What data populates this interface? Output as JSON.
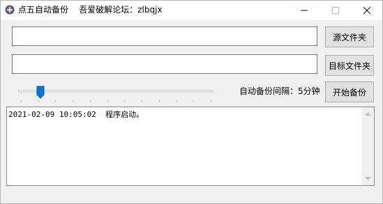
{
  "titlebar": {
    "title": "点五自动备份    吾爱破解论坛：zlbqjx"
  },
  "buttons": {
    "source_folder": "源文件夹",
    "target_folder": "目标文件夹",
    "start_backup": "开始备份"
  },
  "fields": {
    "source_path": "",
    "target_path": ""
  },
  "interval": {
    "label": "自动备份间隔：5分钟",
    "slider_level": 0.08
  },
  "log": {
    "lines": [
      "2021-02-09 10:05:02  程序启动。"
    ]
  },
  "colors": {
    "thumb": "#0078d7",
    "button_bg": "#e1e1e1"
  }
}
